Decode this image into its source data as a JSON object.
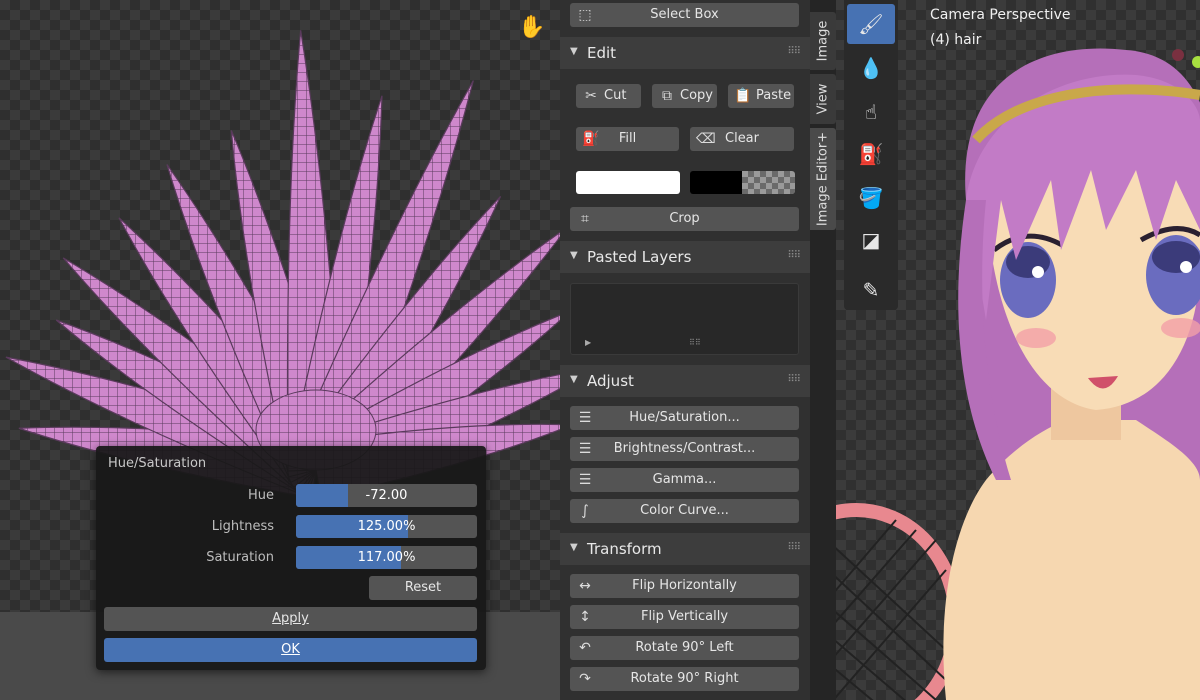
{
  "left_viewport": {
    "icons": {
      "pan": "hand-icon"
    }
  },
  "hue_sat_popup": {
    "title": "Hue/Saturation",
    "hue": {
      "label": "Hue",
      "value": "-72.00",
      "fill_fraction": 0.29
    },
    "lightness": {
      "label": "Lightness",
      "value": "125.00%",
      "fill_fraction": 0.62
    },
    "saturation": {
      "label": "Saturation",
      "value": "117.00%",
      "fill_fraction": 0.58
    },
    "reset_label": "Reset",
    "apply_label": "Apply",
    "ok_label": "OK"
  },
  "sidebar": {
    "select_box_label": "Select Box",
    "edit": {
      "title": "Edit",
      "cut_label": "Cut",
      "copy_label": "Copy",
      "paste_label": "Paste",
      "fill_label": "Fill",
      "clear_label": "Clear",
      "crop_label": "Crop"
    },
    "pasted_layers": {
      "title": "Pasted Layers"
    },
    "adjust": {
      "title": "Adjust",
      "items": [
        "Hue/Saturation...",
        "Brightness/Contrast...",
        "Gamma...",
        "Color Curve..."
      ]
    },
    "transform": {
      "title": "Transform",
      "items": [
        "Flip Horizontally",
        "Flip Vertically",
        "Rotate 90° Left",
        "Rotate 90° Right"
      ]
    }
  },
  "vertical_tabs": [
    "Image",
    "View",
    "Image Editor+"
  ],
  "viewport3d": {
    "camera_label": "Camera Perspective",
    "object_label": "(4) hair",
    "tools": [
      "brush-icon",
      "drop-icon",
      "smear-icon",
      "stamp-icon",
      "fill-bucket-icon",
      "mask-icon",
      "annotate-icon"
    ]
  },
  "colors": {
    "accent": "#4772b3",
    "hair": "#c27bc6",
    "skin": "#f6d7b0"
  }
}
